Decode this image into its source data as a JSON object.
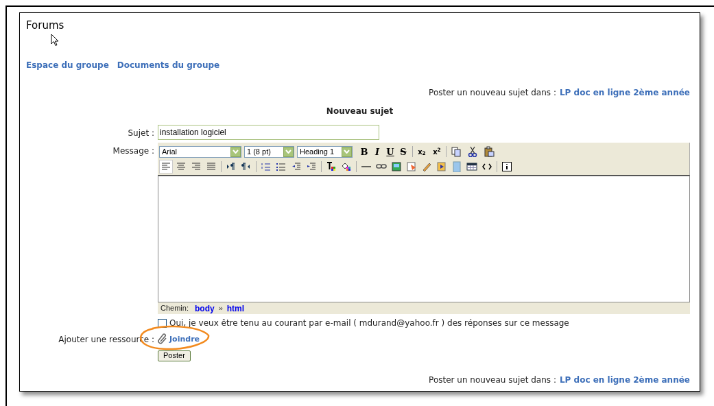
{
  "page": {
    "title": "Forums"
  },
  "nav_links": [
    "Espace du groupe",
    "Documents du groupe"
  ],
  "post_in_top": {
    "label": "Poster un nouveau sujet dans :",
    "forum": "LP doc en ligne 2ème année"
  },
  "form": {
    "heading": "Nouveau sujet",
    "subject": {
      "label": "Sujet :",
      "value": "installation logiciel"
    },
    "message": {
      "label": "Message :",
      "selects": [
        {
          "value": "Arial"
        },
        {
          "value": "1 (8 pt)"
        },
        {
          "value": "Heading 1"
        }
      ],
      "format_buttons": [
        {
          "label": "B",
          "kind": "bold"
        },
        {
          "label": "I",
          "kind": "italic"
        },
        {
          "label": "U",
          "kind": "underline"
        },
        {
          "label": "S",
          "kind": "strike"
        }
      ],
      "script_buttons": [
        "x$_{2}$",
        "x$^{2}$"
      ],
      "row1_icons": [
        {
          "kind": "copy"
        },
        {
          "kind": "cut"
        },
        {
          "kind": "paste"
        }
      ],
      "row2_groups": [
        [
          {
            "kind": "align-left",
            "selected": true
          },
          {
            "kind": "align-center",
            "selected": false
          },
          {
            "kind": "align-right",
            "selected": false
          },
          {
            "kind": "align-justify",
            "selected": false
          }
        ],
        [
          {
            "kind": "ltr",
            "selected": false
          },
          {
            "kind": "rtl",
            "selected": false
          }
        ],
        [
          {
            "kind": "ordered-list",
            "selected": false
          },
          {
            "kind": "bullet-list",
            "selected": false
          },
          {
            "kind": "outdent",
            "selected": false
          },
          {
            "kind": "indent",
            "selected": false
          }
        ],
        [
          {
            "kind": "text-color",
            "selected": false
          },
          {
            "kind": "fill-color",
            "selected": false
          }
        ],
        [
          {
            "kind": "rule",
            "selected": false
          },
          {
            "kind": "link",
            "selected": false
          },
          {
            "kind": "image",
            "selected": false
          },
          {
            "kind": "media",
            "selected": false
          },
          {
            "kind": "cleanup",
            "selected": false
          },
          {
            "kind": "flash",
            "selected": false
          },
          {
            "kind": "calculator",
            "selected": false
          },
          {
            "kind": "table",
            "selected": false
          },
          {
            "kind": "code",
            "selected": false
          }
        ],
        [
          {
            "kind": "info",
            "selected": false
          }
        ]
      ],
      "path": {
        "label": "Chemin:",
        "items": [
          "body",
          "html"
        ],
        "separator": "»"
      }
    },
    "notify": {
      "checked": false,
      "label": "Oui, je veux être tenu au courant par e-mail ( mdurand@yahoo.fr ) des réponses sur ce message"
    },
    "attach": {
      "label": "Ajouter une ressource :",
      "link": "Joindre",
      "highlighted": true
    },
    "submit": "Poster"
  },
  "post_in_bottom": {
    "label": "Poster un nouveau sujet dans :",
    "forum": "LP doc en ligne 2ème année"
  }
}
